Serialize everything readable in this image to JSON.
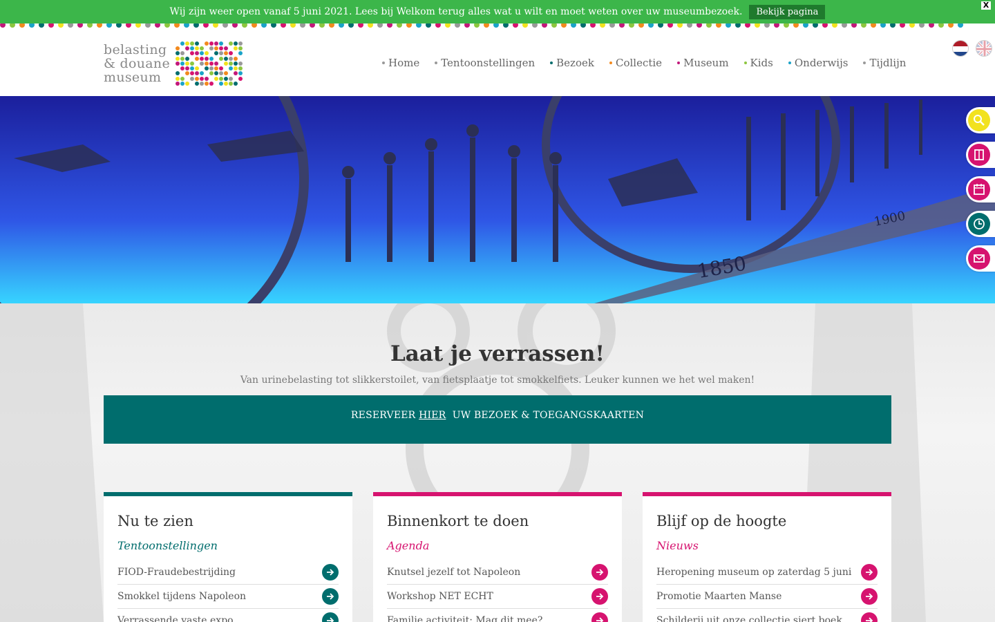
{
  "announcement": {
    "message": "Wij zijn weer open vanaf 5 juni 2021. Lees bij Welkom terug alles wat u wilt en moet weten over uw museumbezoek.",
    "button_label": "Bekijk pagina",
    "close_label": "X"
  },
  "logo": {
    "line1": "belasting",
    "line2": "& douane",
    "line3": "museum"
  },
  "nav": [
    {
      "label": "Home",
      "color": "#999999"
    },
    {
      "label": "Tentoonstellingen",
      "color": "#999999"
    },
    {
      "label": "Bezoek",
      "color": "#006d6d"
    },
    {
      "label": "Collectie",
      "color": "#f28a1e"
    },
    {
      "label": "Museum",
      "color": "#c2187a"
    },
    {
      "label": "Kids",
      "color": "#8dc63f"
    },
    {
      "label": "Onderwijs",
      "color": "#1aa3c8"
    },
    {
      "label": "Tijdlijn",
      "color": "#999999"
    }
  ],
  "flags": [
    "dutch-flag-icon",
    "uk-flag-icon"
  ],
  "side_buttons": [
    {
      "name": "search-icon",
      "color": "#f2e21e"
    },
    {
      "name": "book-icon",
      "color": "#d6136f"
    },
    {
      "name": "calendar-icon",
      "color": "#d6136f"
    },
    {
      "name": "clock-icon",
      "color": "#006d6d"
    },
    {
      "name": "mail-icon",
      "color": "#d6136f"
    }
  ],
  "hero": {
    "year1": "1850",
    "year2": "1900"
  },
  "intro": {
    "title": "Laat je verrassen!",
    "subtitle": "Van urinebelasting tot slikkerstoilet, van fietsplaatje tot smokkelfiets. Leuker kunnen we het wel maken!"
  },
  "reserve": {
    "prefix": "RESERVEER",
    "link": "HIER",
    "suffix": "UW BEZOEK & TOEGANGSKAARTEN"
  },
  "cards": [
    {
      "title": "Nu te zien",
      "subtitle": "Tentoonstellingen",
      "accent": "#006d6d",
      "items": [
        "FIOD-Fraudebestrijding",
        "Smokkel tijdens Napoleon",
        "Verrassende vaste expo"
      ]
    },
    {
      "title": "Binnenkort te doen",
      "subtitle": "Agenda",
      "accent": "#d6136f",
      "items": [
        "Knutsel jezelf tot Napoleon",
        "Workshop NET ECHT",
        "Familie activiteit: Mag dit mee?"
      ]
    },
    {
      "title": "Blijf op de hoogte",
      "subtitle": "Nieuws",
      "accent": "#d6136f",
      "items": [
        "Heropening museum op zaterdag 5 juni",
        "Promotie Maarten Manse",
        "Schilderij uit onze collectie siert boek"
      ]
    }
  ]
}
